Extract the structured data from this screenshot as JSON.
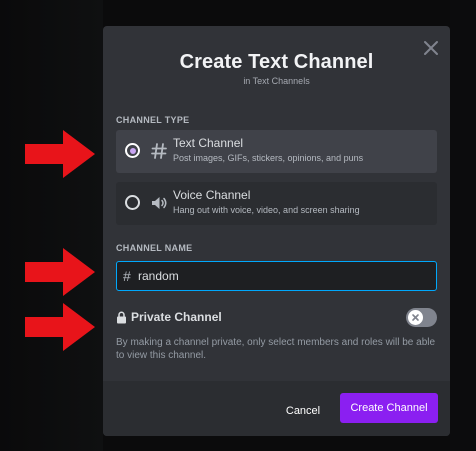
{
  "modal": {
    "title": "Create Text Channel",
    "subtitle": "in Text Channels",
    "close_icon": "close-icon"
  },
  "channel_type": {
    "label": "CHANNEL TYPE",
    "options": [
      {
        "title": "Text Channel",
        "description": "Post images, GIFs, stickers, opinions, and puns",
        "icon": "hash-icon",
        "selected": true
      },
      {
        "title": "Voice Channel",
        "description": "Hang out with voice, video, and screen sharing",
        "icon": "speaker-icon",
        "selected": false
      }
    ]
  },
  "channel_name": {
    "label": "CHANNEL NAME",
    "prefix": "#",
    "value": "random"
  },
  "private_channel": {
    "label": "Private Channel",
    "icon": "lock-icon",
    "enabled": false,
    "description": "By making a channel private, only select members and roles will be able to view this channel."
  },
  "footer": {
    "cancel_label": "Cancel",
    "create_label": "Create Channel"
  },
  "colors": {
    "modal_bg": "#313338",
    "footer_bg": "#2b2d31",
    "selected_option_bg": "#404249",
    "input_border_focus": "#00a8fc",
    "primary_button": "#8b1ff1",
    "radio_selected_dot": "#c9a5f3",
    "annotation_arrow": "#e8141a"
  },
  "annotations": {
    "arrow_icon": "red-arrow-icon",
    "arrow_count": 3
  }
}
